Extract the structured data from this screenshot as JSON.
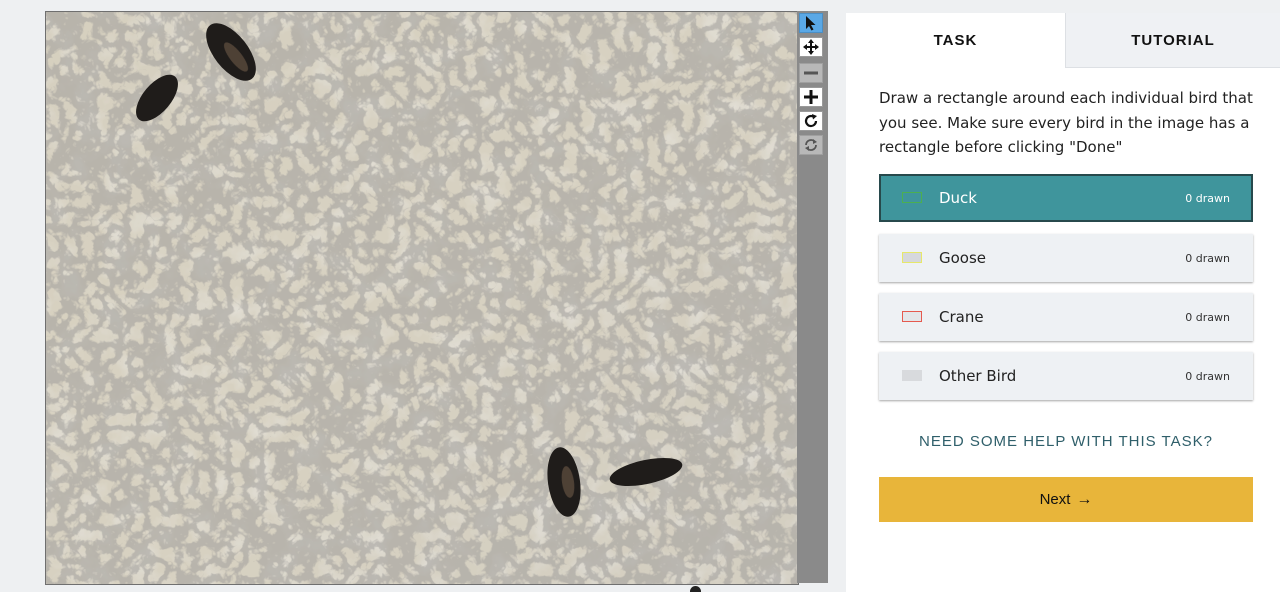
{
  "viewer": {
    "image_description_icon": "bird-photo"
  },
  "toolbar": {
    "tools": [
      {
        "name": "pointer-icon",
        "state": "active"
      },
      {
        "name": "move-icon",
        "state": "normal"
      },
      {
        "name": "zoom-out-icon",
        "state": "disabled"
      },
      {
        "name": "zoom-in-icon",
        "state": "normal"
      },
      {
        "name": "rotate-icon",
        "state": "normal"
      },
      {
        "name": "reset-icon",
        "state": "disabled"
      }
    ]
  },
  "tabs": {
    "task": "TASK",
    "tutorial": "TUTORIAL"
  },
  "task": {
    "instructions": "Draw a rectangle around each individual bird that you see. Make sure every bird in the image has a rectangle before clicking \"Done\"",
    "choices": [
      {
        "label": "Duck",
        "count": "0 drawn",
        "color": "#4caf50",
        "selected": true
      },
      {
        "label": "Goose",
        "count": "0 drawn",
        "color": "#e6e86a",
        "selected": false
      },
      {
        "label": "Crane",
        "count": "0 drawn",
        "color": "#e55a4f",
        "selected": false
      },
      {
        "label": "Other Bird",
        "count": "0 drawn",
        "color": "#d8dadd",
        "selected": false
      }
    ],
    "help_link": "NEED SOME HELP WITH THIS TASK?",
    "next_label": "Next"
  },
  "colors": {
    "selected_choice": "#3f959c",
    "next_button": "#e8b53a",
    "active_tool": "#5aa8e6"
  }
}
